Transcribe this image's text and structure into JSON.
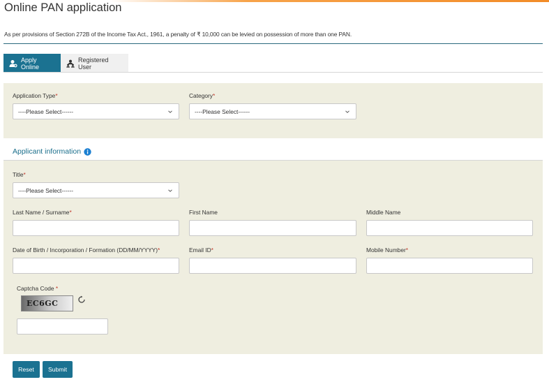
{
  "page": {
    "title": "Online PAN application",
    "notice": "As per provisions of Section 272B of the Income Tax Act., 1961, a penalty of ₹ 10,000 can be levied on possession of more than one PAN."
  },
  "tabs": [
    {
      "label": "Apply Online",
      "icon": "user-add-icon",
      "active": true
    },
    {
      "label": "Registered User",
      "icon": "user-group-icon",
      "active": false
    }
  ],
  "application": {
    "application_type": {
      "label": "Application Type",
      "required": "*",
      "value": "----Please Select------"
    },
    "category": {
      "label": "Category",
      "required": "*",
      "value": "----Please Select------"
    }
  },
  "applicant": {
    "section_title": "Applicant information",
    "title": {
      "label": "Title",
      "required": "*",
      "value": "----Please Select------"
    },
    "last_name": {
      "label": "Last Name / Surname",
      "required": "*",
      "value": ""
    },
    "first_name": {
      "label": "First Name",
      "value": ""
    },
    "middle_name": {
      "label": "Middle Name",
      "value": ""
    },
    "dob": {
      "label": "Date of Birth / Incorporation / Formation (DD/MM/YYYY)",
      "required": "*",
      "value": ""
    },
    "email": {
      "label": "Email ID",
      "required": "*",
      "value": ""
    },
    "mobile": {
      "label": "Mobile Number",
      "required": "*",
      "value": ""
    }
  },
  "captcha": {
    "label": "Captcha Code ",
    "required": "*",
    "image_text": "EC6GC",
    "value": ""
  },
  "buttons": {
    "reset": "Reset",
    "submit": "Submit"
  },
  "colors": {
    "primary": "#1b7291",
    "panel": "#efeee0",
    "required": "#c0392b",
    "accent": "#f28c28"
  }
}
